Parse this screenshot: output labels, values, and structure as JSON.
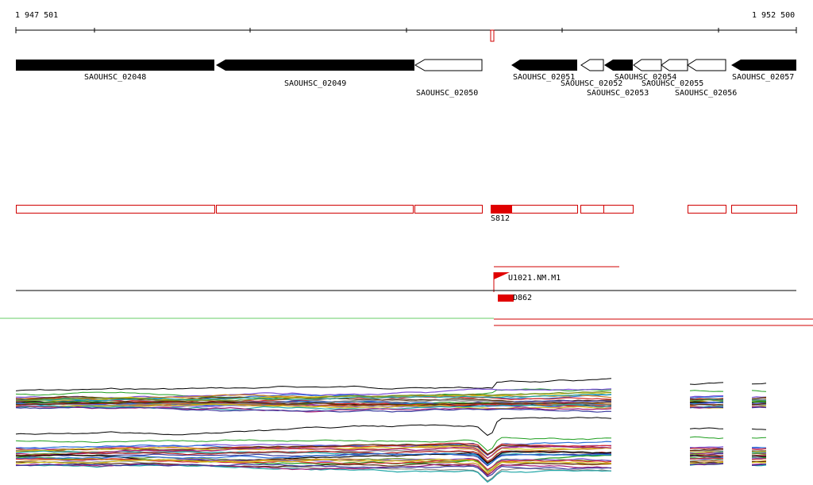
{
  "ruler": {
    "start_label": "1 947 501",
    "end_label": "1 952 500"
  },
  "genes": [
    {
      "name": "SAOUHSC_02048",
      "filled": true
    },
    {
      "name": "SAOUHSC_02049",
      "filled": true
    },
    {
      "name": "SAOUHSC_02050",
      "filled": false
    },
    {
      "name": "SAOUHSC_02051",
      "filled": true
    },
    {
      "name": "SAOUHSC_02052",
      "filled": false
    },
    {
      "name": "SAOUHSC_02053",
      "filled": true
    },
    {
      "name": "SAOUHSC_02054",
      "filled": false
    },
    {
      "name": "SAOUHSC_02055",
      "filled": false
    },
    {
      "name": "SAOUHSC_02056",
      "filled": false
    },
    {
      "name": "SAOUHSC_02057",
      "filled": true
    }
  ],
  "features": {
    "s_label": "S812",
    "u_label": "U1021.NM.M1",
    "d_label": "D862"
  },
  "colors": {
    "gene_fill": "#000000",
    "feature": "#e00000",
    "green_track": "#66cc66",
    "axis": "#000000"
  }
}
